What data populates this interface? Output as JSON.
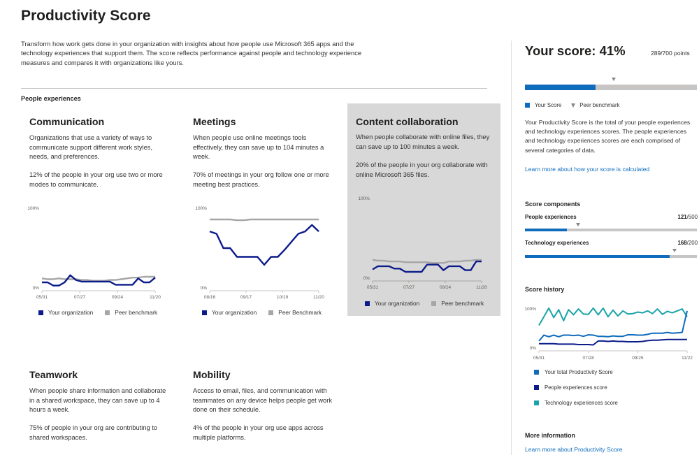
{
  "page": {
    "title": "Productivity Score",
    "intro": "Transform how work gets done in your organization with insights about how people use Microsoft 365 apps and the technology experiences that support them. The score reflects performance against people and technology experience measures and compares it with organizations like yours.",
    "section_label": "People experiences"
  },
  "colors": {
    "org_line": "#0c1b8a",
    "peer_line": "#a6a6a6",
    "accent": "#0f6cbd",
    "teal": "#1aa3a8",
    "highlight_bg": "#d8d8d8"
  },
  "cards": {
    "communication": {
      "title": "Communication",
      "description": "Organizations that use a variety of ways to communicate support different work styles, needs, and preferences.",
      "stat": "12% of the people in your org use two or more modes to communicate.",
      "legend_org": "Your organization",
      "legend_peer": "Peer benchmark"
    },
    "meetings": {
      "title": "Meetings",
      "description": "When people use online meetings tools effectively, they can save up to 104 minutes a week.",
      "stat": "70% of meetings in your org follow one or more meeting best practices.",
      "legend_org": "Your organization",
      "legend_peer": "Peer Benchmark"
    },
    "content": {
      "title": "Content collaboration",
      "description": "When people collaborate with online files, they can save up to 100 minutes a week.",
      "stat": "20% of the people in your org collaborate with online Microsoft 365 files.",
      "legend_org": "Your organization",
      "legend_peer": "Peer benchmark"
    },
    "teamwork": {
      "title": "Teamwork",
      "description": "When people share information and collaborate in a shared workspace, they can save up to 4 hours a week.",
      "stat": "75% of people in your org are contributing to shared workspaces."
    },
    "mobility": {
      "title": "Mobility",
      "description": "Access to email, files, and communication with teammates on any device helps people get work done on their schedule.",
      "stat": "4% of the people in your org use apps across multiple platforms."
    }
  },
  "chart_data": [
    {
      "type": "line",
      "title": "Communication",
      "ylim": [
        0,
        100
      ],
      "ytick_labels": [
        "100%",
        "0%"
      ],
      "x_tick_labels": [
        "05/31",
        "07/27",
        "09/24",
        "11/20"
      ],
      "series": [
        {
          "name": "Your organization",
          "color": "#0c1b8a",
          "values": [
            7,
            7,
            3,
            3,
            7,
            16,
            10,
            8,
            8,
            8,
            8,
            8,
            8,
            4,
            4,
            4,
            4,
            12,
            7,
            7,
            13
          ]
        },
        {
          "name": "Peer benchmark",
          "color": "#a6a6a6",
          "values": [
            12,
            11,
            11,
            12,
            11,
            11,
            11,
            10,
            10,
            9,
            9,
            9,
            10,
            10,
            11,
            12,
            13,
            13,
            14,
            14,
            14
          ]
        }
      ]
    },
    {
      "type": "line",
      "title": "Meetings",
      "ylim": [
        0,
        100
      ],
      "ytick_labels": [
        "100%",
        "0%"
      ],
      "x_tick_labels": [
        "08/16",
        "09/17",
        "10/19",
        "11/20"
      ],
      "series": [
        {
          "name": "Your organization",
          "color": "#0c1b8a",
          "values": [
            71,
            68,
            50,
            50,
            39,
            39,
            39,
            39,
            29,
            39,
            39,
            48,
            58,
            68,
            71,
            79,
            71
          ]
        },
        {
          "name": "Peer Benchmark",
          "color": "#a6a6a6",
          "values": [
            86,
            86,
            86,
            86,
            85,
            85,
            86,
            86,
            86,
            86,
            86,
            86,
            86,
            86,
            86,
            86,
            86
          ]
        }
      ]
    },
    {
      "type": "line",
      "title": "Content collaboration",
      "ylim": [
        0,
        100
      ],
      "ytick_labels": [
        "100%",
        "0%"
      ],
      "x_tick_labels": [
        "05/31",
        "07/27",
        "09/24",
        "11/20"
      ],
      "series": [
        {
          "name": "Your organization",
          "color": "#0c1b8a",
          "values": [
            11,
            15,
            15,
            15,
            12,
            12,
            8,
            8,
            8,
            8,
            17,
            17,
            17,
            10,
            15,
            15,
            15,
            10,
            10,
            21,
            21
          ]
        },
        {
          "name": "Peer benchmark",
          "color": "#a6a6a6",
          "values": [
            23,
            22,
            22,
            21,
            21,
            21,
            20,
            20,
            20,
            20,
            20,
            19,
            19,
            19,
            21,
            21,
            21,
            22,
            22,
            23,
            23
          ]
        }
      ]
    },
    {
      "type": "line",
      "title": "Score history",
      "ylim": [
        0,
        100
      ],
      "ytick_labels": [
        "100%",
        "0%"
      ],
      "x_tick_labels": [
        "05/31",
        "07/28",
        "09/25",
        "11/22"
      ],
      "series": [
        {
          "name": "Your total Productivity Score",
          "color": "#0f6cbd",
          "values": [
            18,
            33,
            29,
            33,
            29,
            33,
            33,
            32,
            33,
            30,
            34,
            33,
            30,
            30,
            29,
            31,
            30,
            30,
            34,
            34,
            33,
            33,
            35,
            38,
            38,
            38,
            40,
            38,
            39,
            40,
            95
          ]
        },
        {
          "name": "People experiences score",
          "color": "#0c1b8a",
          "values": [
            11,
            11,
            11,
            11,
            10,
            10,
            10,
            10,
            9,
            9,
            9,
            8,
            18,
            18,
            17,
            18,
            17,
            17,
            16,
            16,
            16,
            17,
            19,
            20,
            20,
            21,
            22,
            22,
            22,
            22,
            22
          ]
        },
        {
          "name": "Technology experiences score",
          "color": "#1aa3a8",
          "values": [
            58,
            80,
            102,
            78,
            98,
            70,
            98,
            85,
            100,
            87,
            86,
            102,
            85,
            102,
            80,
            97,
            82,
            95,
            87,
            88,
            92,
            90,
            95,
            88,
            100,
            86,
            94,
            90,
            95,
            100,
            80
          ]
        }
      ]
    }
  ],
  "right_panel": {
    "score_label": "Your score: 41%",
    "points": "289/700 points",
    "score_fraction": 0.41,
    "benchmark_fraction": 0.52,
    "legend_your_score": "Your Score",
    "legend_peer": "Peer benchmark",
    "description": "Your Productivity Score is the total of your people experiences and technology experiences scores. The people experiences and technology experiences scores are each comprised of several categories of data.",
    "learn_calc_link": "Learn more about how your score is calculated",
    "components_heading": "Score components",
    "components": [
      {
        "label": "People experiences",
        "value": "121",
        "total": "/500",
        "fraction": 0.242,
        "benchmark_fraction": 0.31
      },
      {
        "label": "Technology experiences",
        "value": "168",
        "total": "/200",
        "fraction": 0.84,
        "benchmark_fraction": 0.87
      }
    ],
    "history_heading": "Score history",
    "history_legend": [
      "Your total Productivity Score",
      "People experiences score",
      "Technology experiences score"
    ],
    "more_info_heading": "More information",
    "more_info_link": "Learn more about Productivity Score"
  }
}
